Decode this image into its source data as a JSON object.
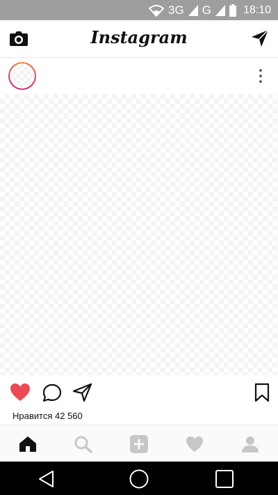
{
  "status_bar": {
    "network_label": "3G",
    "carrier_label": "G",
    "time": "18:10",
    "icons": [
      "wifi-icon",
      "signal-icon",
      "signal-icon-2",
      "battery-icon"
    ]
  },
  "top_bar": {
    "title": "Instagram",
    "left_icon": "camera-icon",
    "right_icon": "direct-send-icon"
  },
  "post": {
    "menu_icon": "more-vertical-icon",
    "likes_text": "Нравится 42 560",
    "actions": {
      "like_icon": "heart-filled-icon",
      "comment_icon": "comment-icon",
      "share_icon": "share-icon",
      "save_icon": "bookmark-icon"
    }
  },
  "bottom_nav": {
    "items": [
      "home-icon",
      "search-icon",
      "add-icon",
      "activity-heart-icon",
      "profile-icon"
    ],
    "active": "home-icon"
  },
  "colors": {
    "status_bar": "#9e9e9e",
    "like_red": "#ed4956",
    "inactive_icon": "#c7c7c7",
    "text": "#111111"
  }
}
